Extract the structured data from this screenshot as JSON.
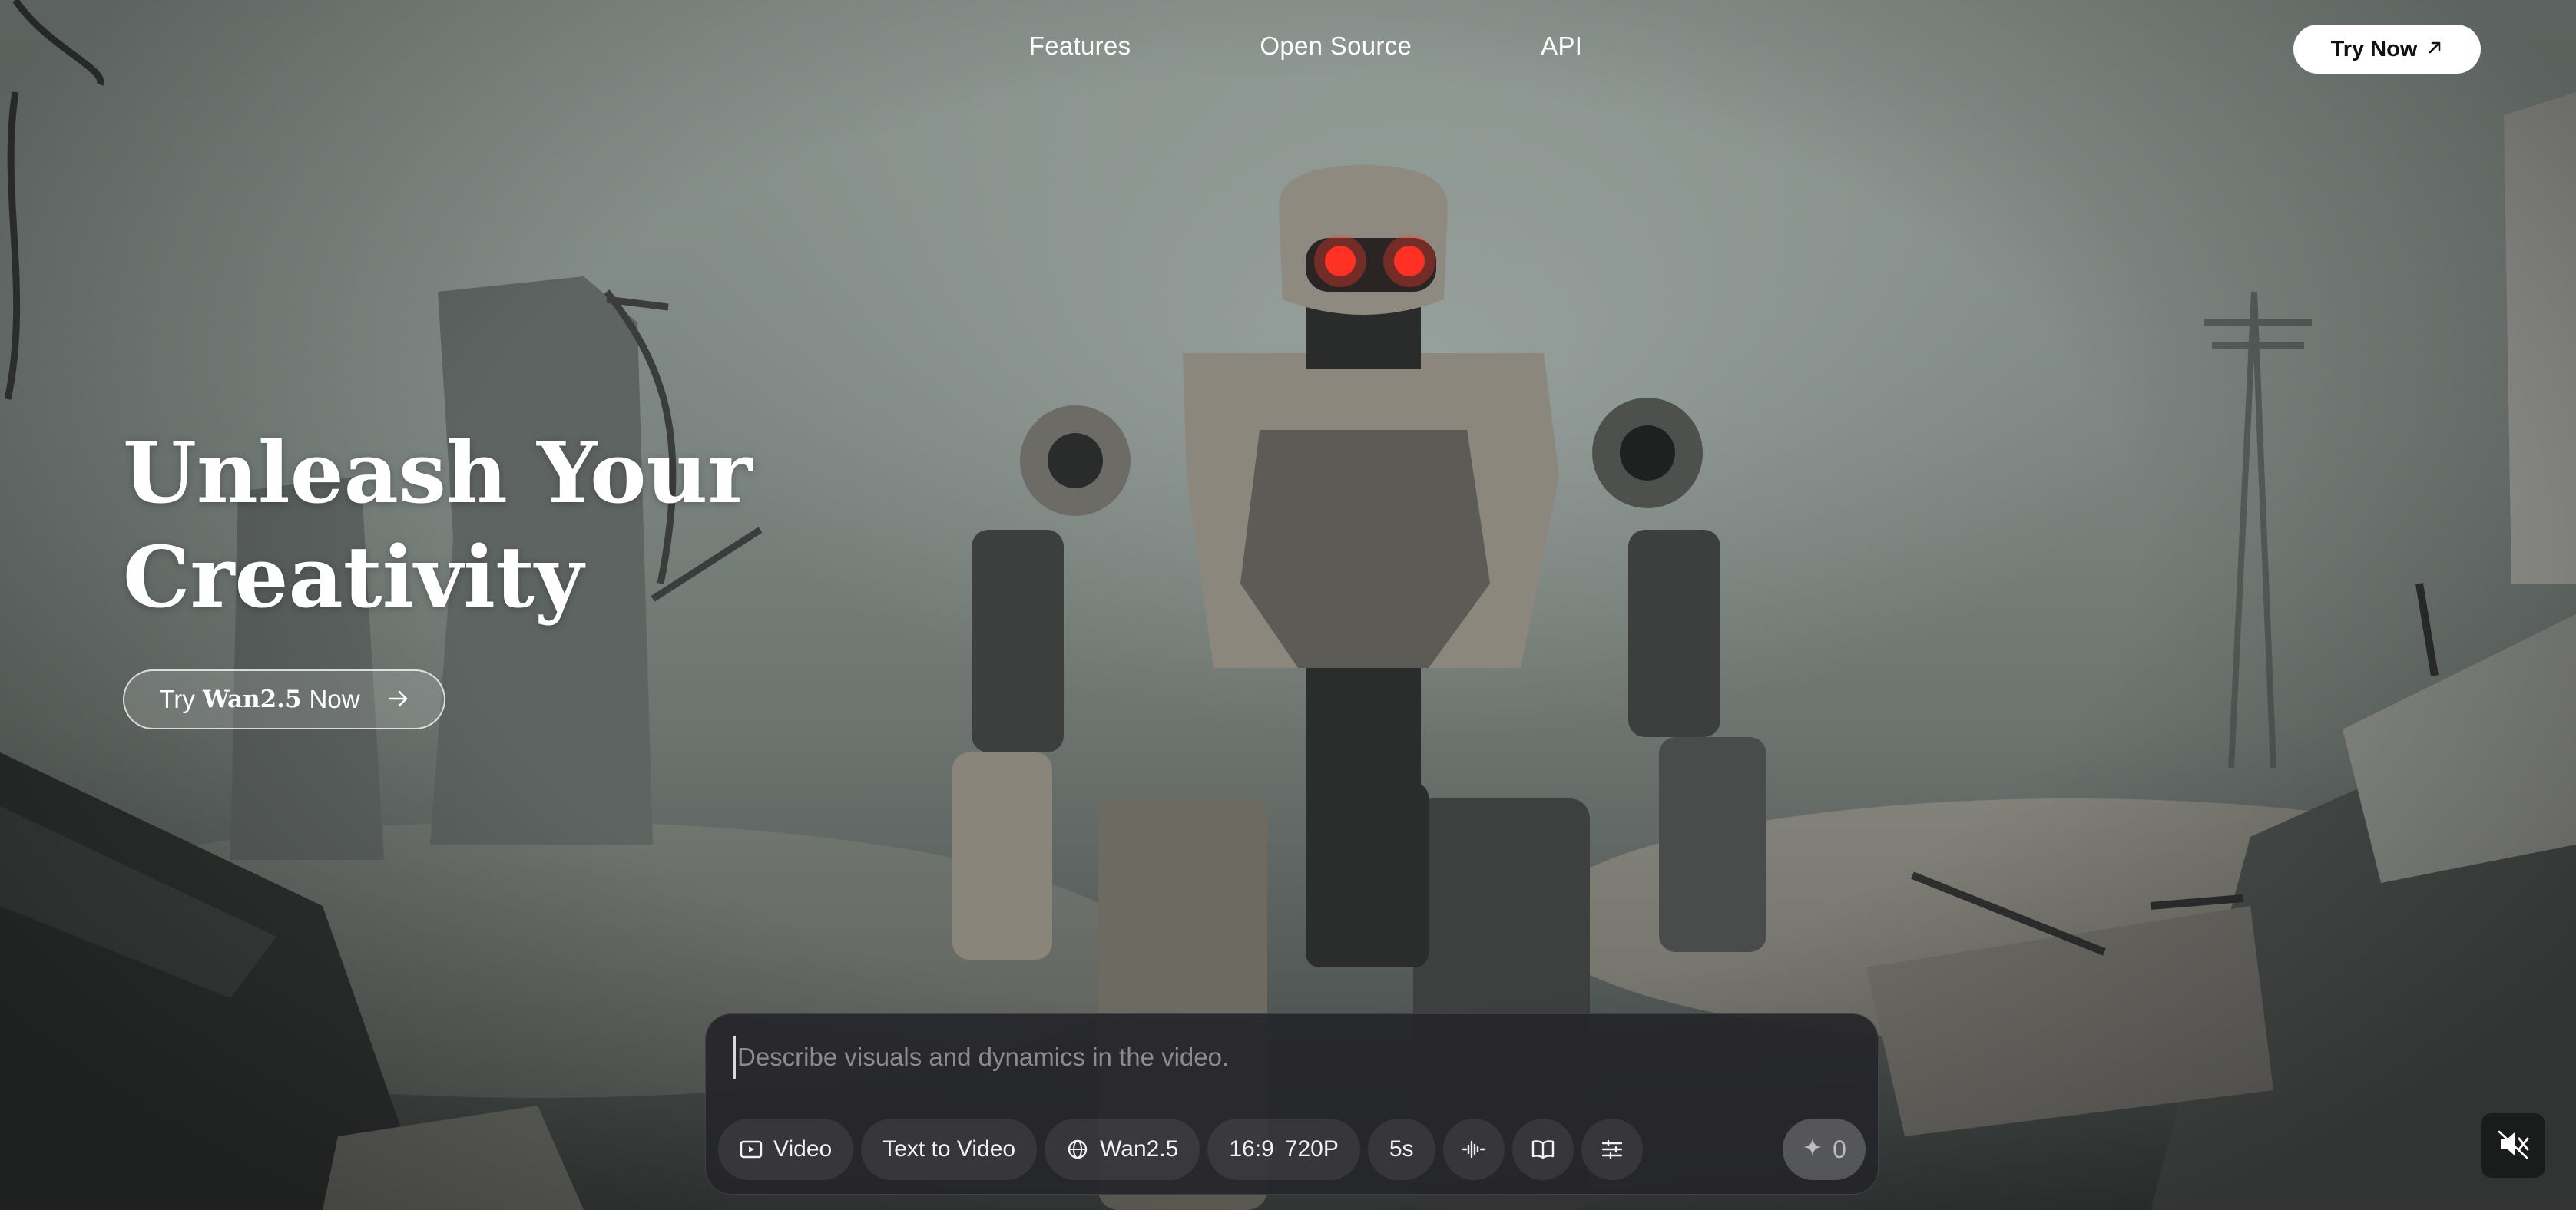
{
  "nav": {
    "items": [
      {
        "label": "Features"
      },
      {
        "label": "Open Source"
      },
      {
        "label": "API"
      }
    ],
    "try_now": "Try Now"
  },
  "hero": {
    "title_line1": "Unleash Your",
    "title_line2": "Creativity",
    "cta_prefix": "Try",
    "cta_brand": "Wan2.5",
    "cta_suffix": "Now"
  },
  "composer": {
    "placeholder": "Describe visuals and dynamics in the video.",
    "mode_label": "Video",
    "task_label": "Text to Video",
    "model_label": "Wan2.5",
    "aspect_ratio": "16:9",
    "resolution": "720P",
    "duration": "5s",
    "credits": "0"
  },
  "icons": {
    "try_now": "arrow-up-right-icon",
    "cta": "arrow-right-icon",
    "mode": "video-icon",
    "model": "globe-icon",
    "audio": "audio-waveform-icon",
    "prompt_library": "book-icon",
    "settings": "sliders-icon",
    "credits": "sparkle-icon",
    "sound": "speaker-muted-icon"
  }
}
